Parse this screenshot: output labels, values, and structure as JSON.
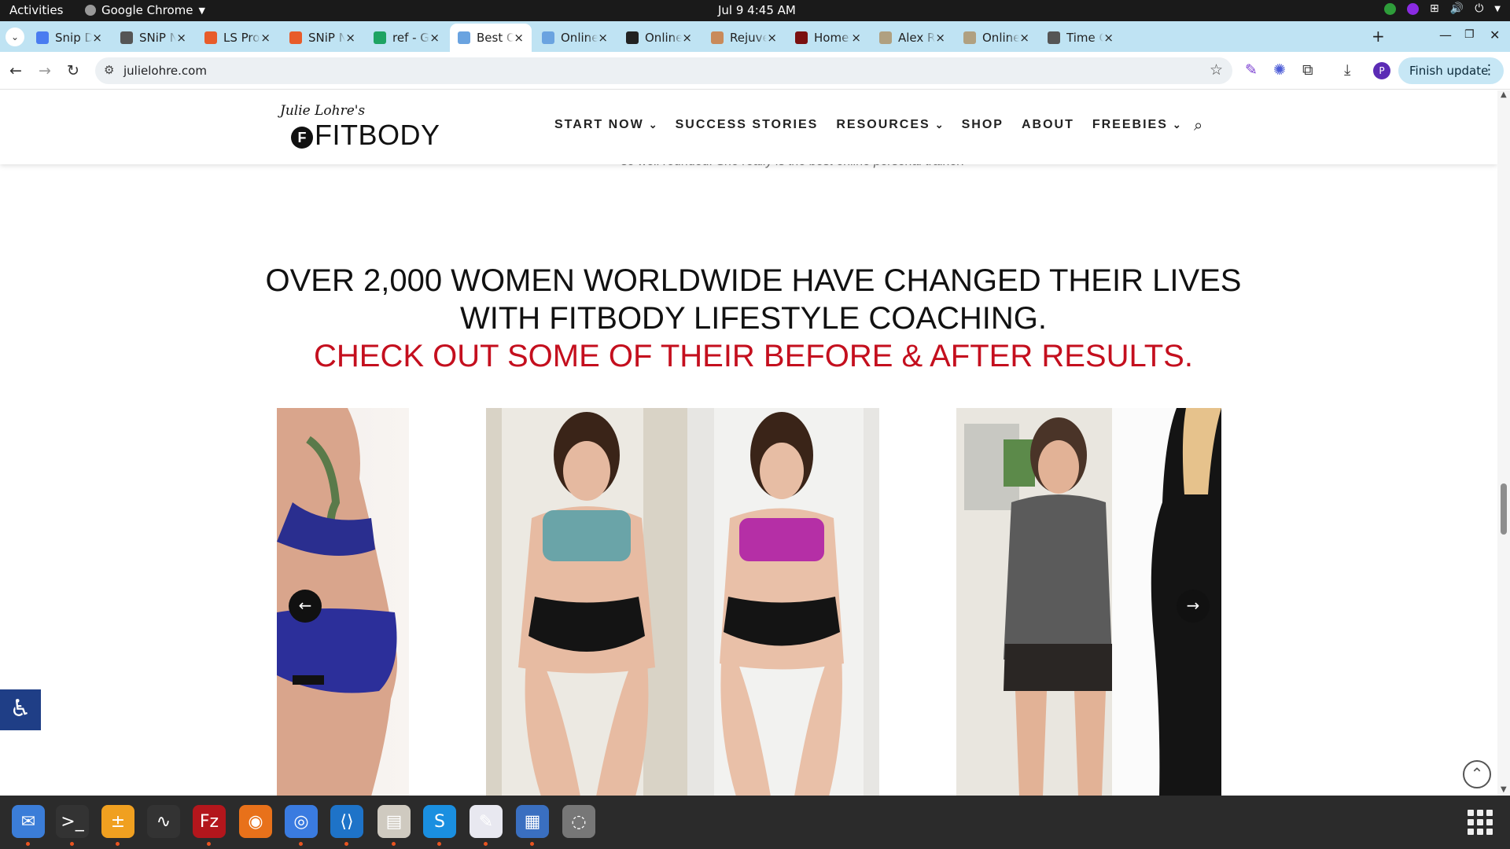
{
  "system_bar": {
    "activities": "Activities",
    "app_name": "Google Chrome",
    "clock": "Jul 9  4:45 AM"
  },
  "tabs": [
    {
      "title": "Snip Det",
      "favicon_color": "#4a7cf0"
    },
    {
      "title": "SNiP Nut",
      "favicon_color": "#555555"
    },
    {
      "title": "LS Pro Sy",
      "favicon_color": "#e85c2a"
    },
    {
      "title": "SNiP Nut",
      "favicon_color": "#e85c2a"
    },
    {
      "title": "ref - Goo",
      "favicon_color": "#1ea362"
    },
    {
      "title": "Best Onl",
      "favicon_color": "#6aa3e0",
      "active": true
    },
    {
      "title": "Online Fi",
      "favicon_color": "#6aa3e0"
    },
    {
      "title": "Online Fi",
      "favicon_color": "#222222"
    },
    {
      "title": "Rejuvena",
      "favicon_color": "#c98a5a"
    },
    {
      "title": "Home | D",
      "favicon_color": "#7a1010"
    },
    {
      "title": "Alex Rea",
      "favicon_color": "#b0a080"
    },
    {
      "title": "Online P",
      "favicon_color": "#b0a080"
    },
    {
      "title": "Time Cal",
      "favicon_color": "#555555"
    }
  ],
  "toolbar": {
    "url": "julielohre.com",
    "finish_update": "Finish update",
    "profile_initial": "P"
  },
  "site": {
    "logo_script": "Julie Lohre's",
    "logo_mark": "F",
    "logo_word": "FITBODY",
    "nav": [
      {
        "label": "START NOW",
        "dropdown": true
      },
      {
        "label": "SUCCESS STORIES",
        "dropdown": false
      },
      {
        "label": "RESOURCES",
        "dropdown": true
      },
      {
        "label": "SHOP",
        "dropdown": false
      },
      {
        "label": "ABOUT",
        "dropdown": false
      },
      {
        "label": "FREEBIES",
        "dropdown": true
      }
    ],
    "testimonial_fragment": "so well rounded. She really is the best online personal trainer!",
    "headline_line1": "OVER 2,000 WOMEN WORLDWIDE HAVE CHANGED THEIR LIVES",
    "headline_line2": "WITH FITBODY LIFESTYLE COACHING.",
    "headline_line3": "CHECK OUT SOME OF THEIR BEFORE & AFTER RESULTS.",
    "accent_red": "#c40f1e"
  },
  "carousel": {
    "prev_icon": "arrow-left-icon",
    "next_icon": "arrow-right-icon"
  },
  "dock": [
    "Thunderbird",
    "Terminal",
    "Calculator",
    "System Monitor",
    "FileZilla",
    "Firefox",
    "Chrome",
    "VS Code",
    "Files",
    "Skype",
    "Text Editor",
    "LibreOffice Writer",
    "Disks"
  ]
}
